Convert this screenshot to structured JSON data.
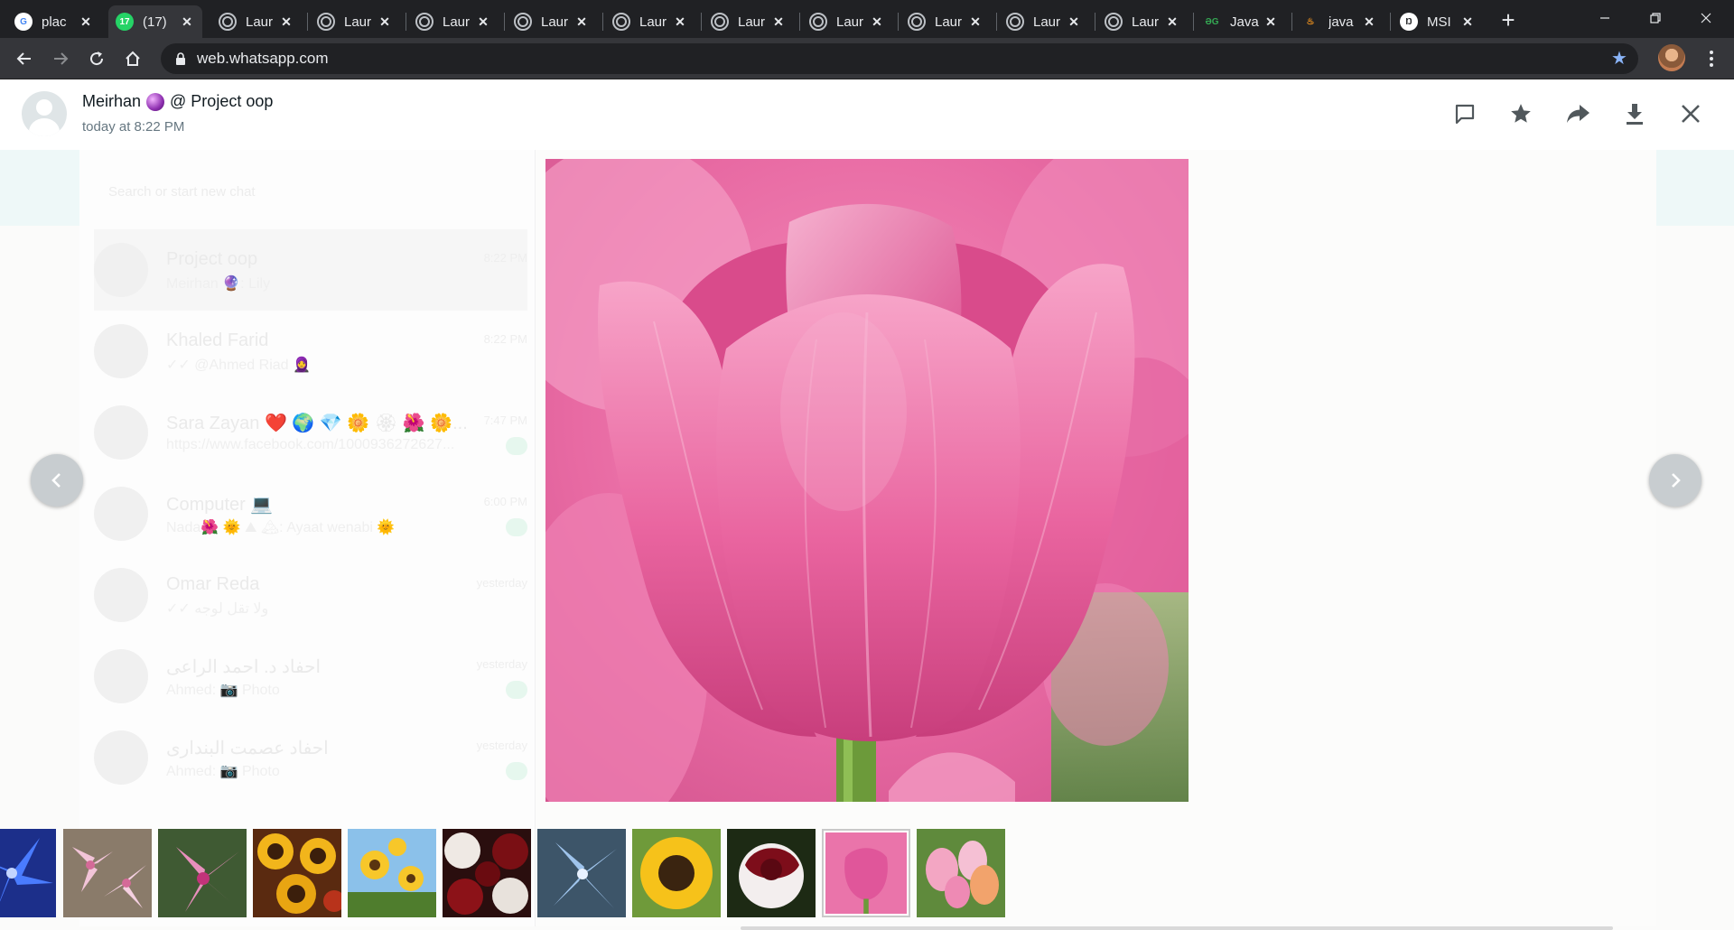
{
  "browser": {
    "tabs": [
      {
        "title": "plac",
        "favicon": "google-icon"
      },
      {
        "title": "(17)",
        "favicon": "whatsapp-icon",
        "active": true
      },
      {
        "title": "Laur",
        "favicon": "globe-icon"
      },
      {
        "title": "Laur",
        "favicon": "globe-icon"
      },
      {
        "title": "Laur",
        "favicon": "globe-icon"
      },
      {
        "title": "Laur",
        "favicon": "globe-icon"
      },
      {
        "title": "Laur",
        "favicon": "globe-icon"
      },
      {
        "title": "Laur",
        "favicon": "globe-icon"
      },
      {
        "title": "Laur",
        "favicon": "globe-icon"
      },
      {
        "title": "Laur",
        "favicon": "globe-icon"
      },
      {
        "title": "Laur",
        "favicon": "globe-icon"
      },
      {
        "title": "Laur",
        "favicon": "globe-icon"
      },
      {
        "title": "Java",
        "favicon": "geeksforgeeks-icon"
      },
      {
        "title": "java",
        "favicon": "java-icon"
      },
      {
        "title": "MSI",
        "favicon": "msi-icon"
      }
    ],
    "url": "web.whatsapp.com",
    "favicon_text": {
      "google": "G",
      "whatsapp": "17",
      "gg": "ƏG",
      "java": "♨",
      "msi": "Ŋ"
    }
  },
  "viewer": {
    "sender_name": "Meirhan",
    "group": "@ Project oop",
    "timestamp": "today at 8:22 PM",
    "selected_thumbnail_index": 9,
    "thumbnails": [
      {
        "name": "thumb-blue-lily",
        "subject": "blue lily"
      },
      {
        "name": "thumb-pink-lilies",
        "subject": "pink lilies"
      },
      {
        "name": "thumb-pink-lily",
        "subject": "pink lily"
      },
      {
        "name": "thumb-sunflowers-bouquet",
        "subject": "sunflowers bouquet"
      },
      {
        "name": "thumb-sunflowers-sky",
        "subject": "sunflowers sky"
      },
      {
        "name": "thumb-red-white-roses",
        "subject": "red and white roses"
      },
      {
        "name": "thumb-blue-lilies",
        "subject": "blue lilies"
      },
      {
        "name": "thumb-sunflower",
        "subject": "sunflower"
      },
      {
        "name": "thumb-red-white-rose",
        "subject": "red and white rose"
      },
      {
        "name": "thumb-pink-tulip",
        "subject": "pink tulip"
      },
      {
        "name": "thumb-tulips",
        "subject": "tulips"
      }
    ]
  },
  "background_chats": {
    "search_placeholder": "Search or start new chat",
    "items": [
      {
        "name": "Project oop",
        "preview": "Meirhan 🔮: Lily",
        "time": "8:22 PM"
      },
      {
        "name": "Khaled Farid",
        "preview": "✓✓ @Ahmed Riad 🧕",
        "time": "8:22 PM"
      },
      {
        "name": "Sara Zayan ❤️ 🌍 💎 🌼 🏵 🌺 🌼...",
        "preview": "https://www.facebook.com/1000936272627...",
        "time": "7:47 PM"
      },
      {
        "name": "Computer 💻",
        "preview": "Nada🌺 🌞 ⛰ 🏔: Ayaat wenabi 🌞",
        "time": "6:00 PM"
      },
      {
        "name": "Omar Reda",
        "preview": "✓✓ ولا تقل لوجه",
        "time": "yesterday"
      },
      {
        "name": "احفاد د. احمد الراعى",
        "preview": "Ahmed: 📷 Photo",
        "time": "yesterday"
      },
      {
        "name": "احفاد عصمت البندارى",
        "preview": "Ahmed: 📷 Photo",
        "time": "yesterday"
      }
    ]
  },
  "colors": {
    "chrome_dark": "#202124",
    "chrome_toolbar": "#35363a",
    "whatsapp_green": "#25d366",
    "text_primary": "#111b21",
    "text_secondary": "#667781",
    "icon": "#51585c",
    "tulip_pink": "#e55a99",
    "bookmark_star": "#8ab4f8"
  }
}
